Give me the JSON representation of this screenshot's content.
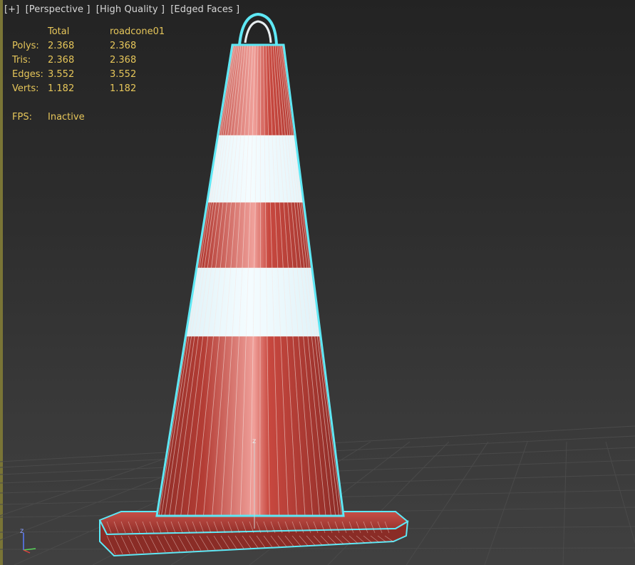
{
  "viewport": {
    "labels": [
      "[+]",
      "[Perspective ]",
      "[High Quality ]",
      "[Edged Faces ]"
    ]
  },
  "stats": {
    "header": {
      "total": "Total",
      "object": "roadcone01"
    },
    "rows": [
      {
        "label": "Polys:",
        "total": "2.368",
        "object": "2.368"
      },
      {
        "label": "Tris:",
        "total": "2.368",
        "object": "2.368"
      },
      {
        "label": "Edges:",
        "total": "3.552",
        "object": "3.552"
      },
      {
        "label": "Verts:",
        "total": "1.182",
        "object": "1.182"
      }
    ],
    "fps": {
      "label": "FPS:",
      "value": "Inactive"
    }
  },
  "gizmo": {
    "z_label": "z",
    "axis_label": "z"
  },
  "colors": {
    "cone_red": "#c0433a",
    "stripe": "#e2f5fb",
    "selection_outline": "#5ee8f5",
    "stat_text": "#e6c65a"
  },
  "icons": {
    "axis_tripod": "axis-tripod-icon"
  }
}
